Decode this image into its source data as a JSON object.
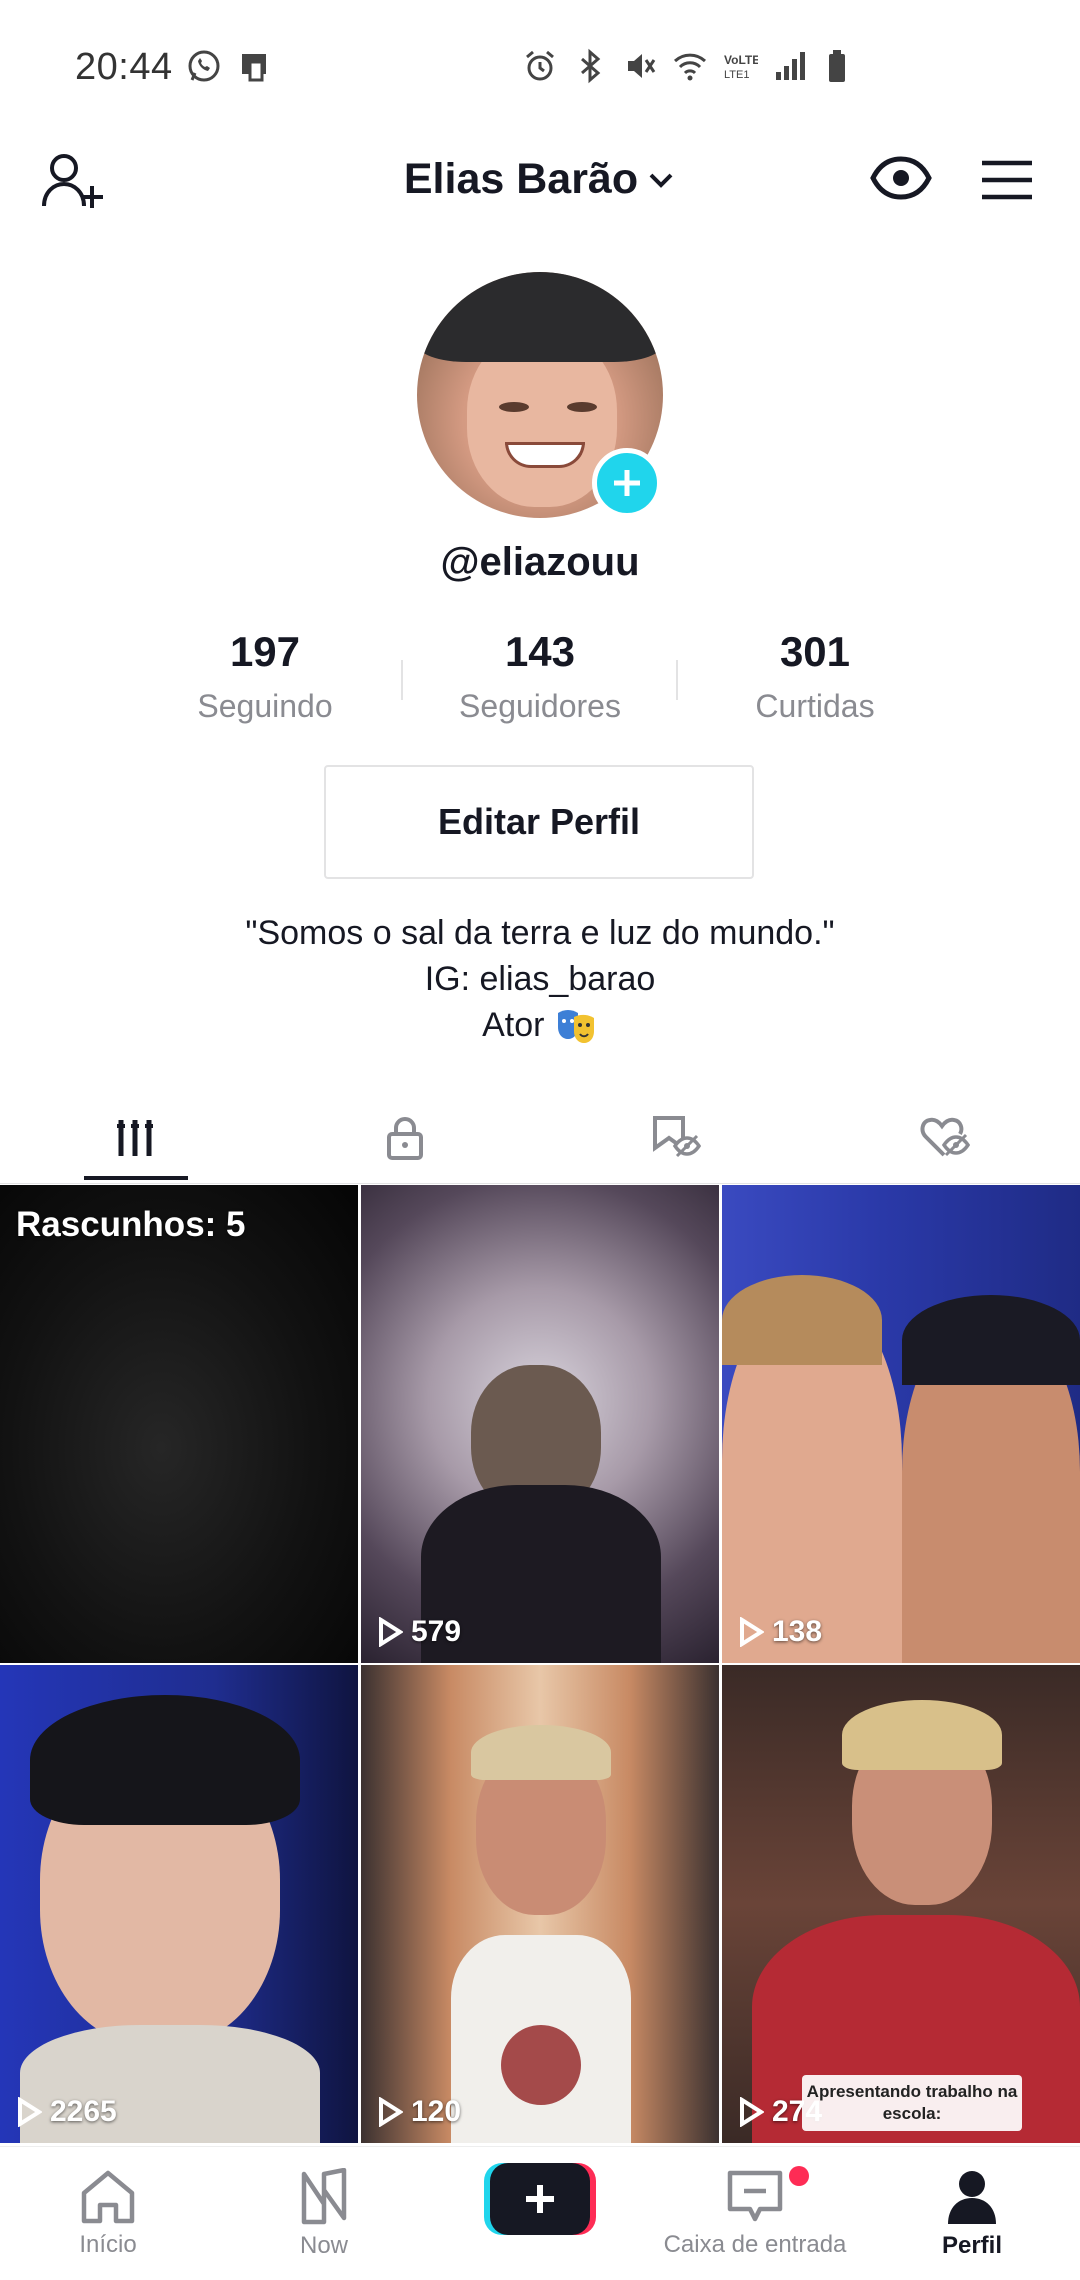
{
  "status_bar": {
    "time": "20:44",
    "left_icons": [
      "whatsapp-icon",
      "phone-screen-icon"
    ],
    "right_icons": [
      "alarm-icon",
      "bluetooth-icon",
      "mute-icon",
      "wifi-icon",
      "volte-icon",
      "signal-icon",
      "battery-icon"
    ]
  },
  "header": {
    "account_name": "Elias Barão",
    "icons": {
      "left": "add-user-icon",
      "eye": "eye-icon",
      "menu": "hamburger-menu-icon"
    }
  },
  "profile": {
    "handle": "@eliazouu",
    "stats": [
      {
        "value": "197",
        "label": "Seguindo"
      },
      {
        "value": "143",
        "label": "Seguidores"
      },
      {
        "value": "301",
        "label": "Curtidas"
      }
    ],
    "edit_button": "Editar Perfil",
    "bio": {
      "line1": "\"Somos o sal da terra e luz do mundo.\"",
      "line2": "IG: elias_barao",
      "line3": "Ator",
      "line3_emoji": "theater-masks-icon"
    }
  },
  "tabs": [
    {
      "id": "videos",
      "icon": "grid-bars-icon",
      "active": true
    },
    {
      "id": "private",
      "icon": "lock-icon",
      "active": false
    },
    {
      "id": "favorites",
      "icon": "bookmark-hidden-icon",
      "active": false
    },
    {
      "id": "liked",
      "icon": "heart-hidden-icon",
      "active": false
    }
  ],
  "grid": {
    "drafts_label": "Rascunhos: 5",
    "videos": [
      {
        "views": "579"
      },
      {
        "views": "138"
      },
      {
        "views": "2265"
      },
      {
        "views": "120"
      },
      {
        "views": "274",
        "caption": "Apresentando trabalho na escola:"
      }
    ]
  },
  "bottom_nav": [
    {
      "label": "Início",
      "icon": "home-icon",
      "active": false
    },
    {
      "label": "Now",
      "icon": "now-icon",
      "active": false
    },
    {
      "label": "",
      "icon": "create-plus-icon",
      "active": false
    },
    {
      "label": "Caixa de entrada",
      "icon": "inbox-icon",
      "active": false,
      "badge": true
    },
    {
      "label": "Perfil",
      "icon": "profile-icon",
      "active": true
    }
  ],
  "colors": {
    "accent_cyan": "#20d5ec",
    "accent_red": "#fe2c55",
    "text_primary": "#161823",
    "text_secondary": "#8a8b91"
  }
}
